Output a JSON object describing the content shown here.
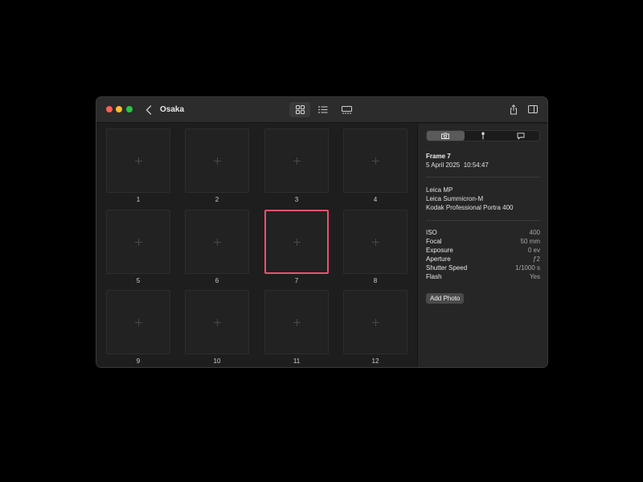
{
  "window": {
    "title": "Osaka"
  },
  "colors": {
    "selection": "#f0506e",
    "close": "#ff5f57",
    "minimize": "#febc2e",
    "zoom": "#28c840"
  },
  "toolbar": {
    "view_modes": [
      "grid-icon",
      "list-icon",
      "filmstrip-icon"
    ],
    "active_view": "grid"
  },
  "grid": {
    "selected": 7,
    "frames": [
      "1",
      "2",
      "3",
      "4",
      "5",
      "6",
      "7",
      "8",
      "9",
      "10",
      "11",
      "12"
    ]
  },
  "inspector": {
    "tabs": [
      "camera-icon",
      "pin-icon",
      "comment-icon"
    ],
    "active_tab": "camera",
    "frame_title": "Frame 7",
    "frame_date": "5 April 2025  10:54:47",
    "camera": "Leica MP",
    "lens": "Leica Summicron-M",
    "film": "Kodak Professional Portra 400",
    "meta": [
      {
        "key": "ISO",
        "value": "400"
      },
      {
        "key": "Focal",
        "value": "50 mm"
      },
      {
        "key": "Exposure",
        "value": "0 ev"
      },
      {
        "key": "Aperture",
        "value": "ƒ2"
      },
      {
        "key": "Shutter Speed",
        "value": "1/1000 s"
      },
      {
        "key": "Flash",
        "value": "Yes"
      }
    ],
    "add_photo_label": "Add Photo"
  }
}
